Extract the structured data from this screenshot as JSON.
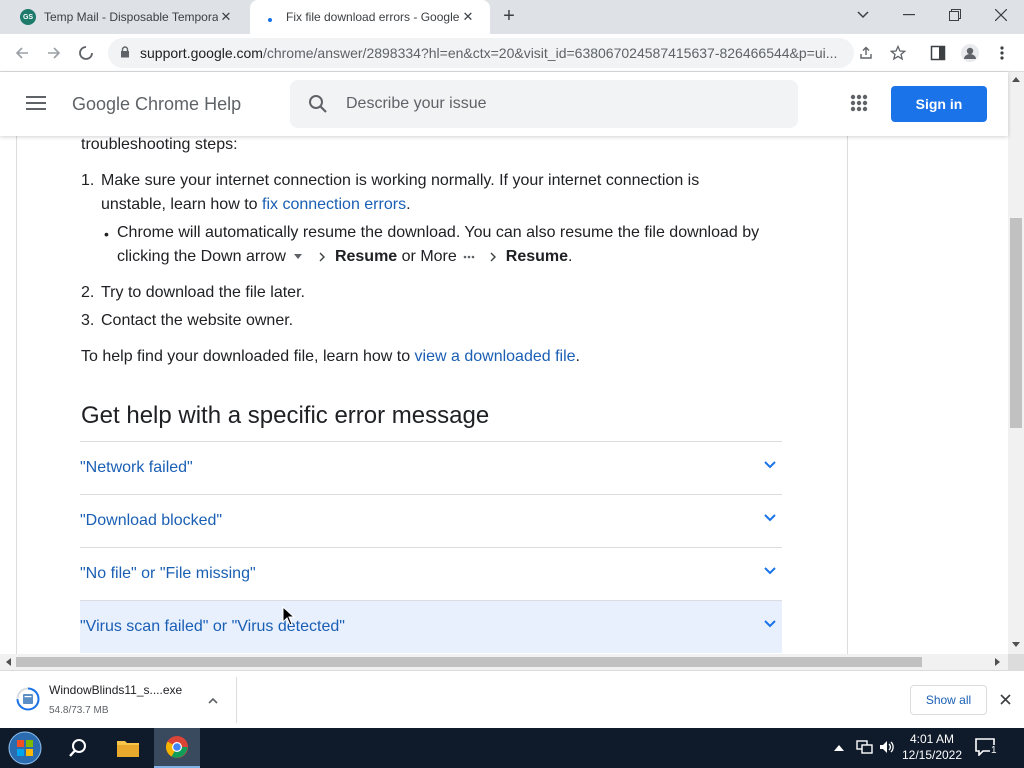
{
  "tabs": [
    {
      "title": "Temp Mail - Disposable Temporary",
      "favicon": "tempmail-icon",
      "active": false
    },
    {
      "title": "Fix file download errors - Google",
      "favicon": "loading-icon",
      "active": true
    }
  ],
  "omnibox": {
    "url_host": "support.google.com",
    "url_rest": "/chrome/answer/2898334?hl=en&ctx=20&visit_id=638067024587415637-826466544&p=ui..."
  },
  "header": {
    "site_title": "Google Chrome Help",
    "search_placeholder": "Describe your issue",
    "signin_label": "Sign in"
  },
  "article": {
    "intro_tail": "troubleshooting steps:",
    "steps": [
      {
        "num": "1.",
        "line1": "Make sure your internet connection is working normally. If your internet connection is",
        "line2_pre": "unstable, learn how to ",
        "line2_link": "fix connection errors",
        "line2_post": "."
      },
      {
        "num": "2.",
        "text": "Try to download the file later."
      },
      {
        "num": "3.",
        "text": "Contact the website owner."
      }
    ],
    "sub_bullet": {
      "line1": "Chrome will automatically resume the download. You can also resume the file download by",
      "line2_pre": "clicking the Down arrow",
      "resume1": "Resume",
      "or_more": " or More",
      "resume2": "Resume",
      "end": "."
    },
    "find_pre": "To help find your downloaded file, learn how to ",
    "find_link": "view a downloaded file",
    "find_post": ".",
    "heading": "Get help with a specific error message",
    "accordion": [
      {
        "label": "\"Network failed\""
      },
      {
        "label": "\"Download blocked\""
      },
      {
        "label": "\"No file\" or \"File missing\""
      },
      {
        "label": "\"Virus scan failed\" or \"Virus detected\""
      }
    ]
  },
  "download": {
    "filename": "WindowBlinds11_s....exe",
    "progress_text": "54.8/73.7 MB",
    "progress_fraction": 0.744,
    "show_all_label": "Show all"
  },
  "taskbar": {
    "time": "4:01 AM",
    "date": "12/15/2022",
    "notification_count": "1"
  },
  "colors": {
    "accent": "#1a73e8",
    "link": "#1a5fb4",
    "hover_row": "#e8f0fe"
  }
}
